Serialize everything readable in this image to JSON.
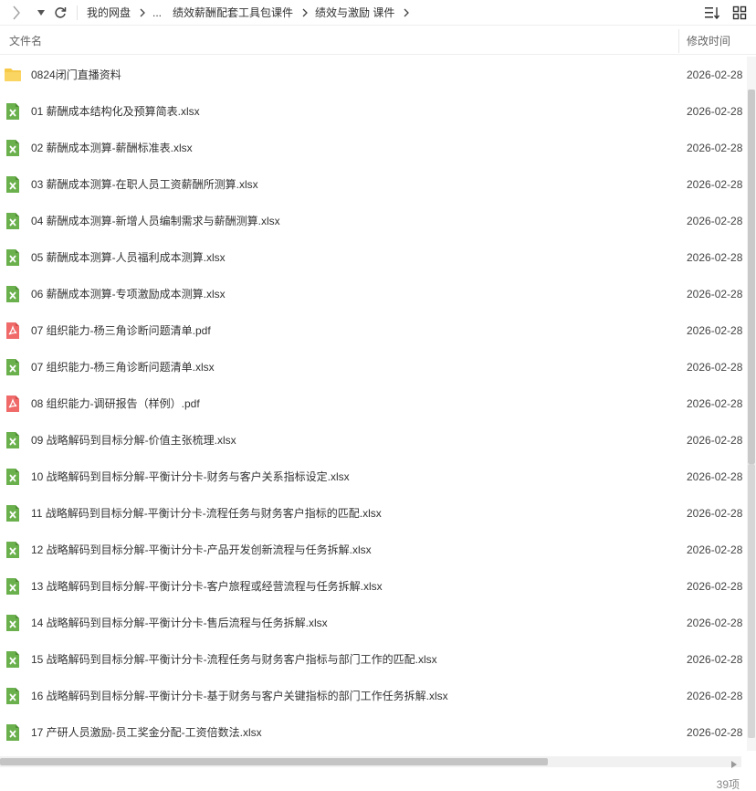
{
  "breadcrumb": {
    "root": "我的网盘",
    "ellipsis": "...",
    "parent": "绩效薪酬配套工具包课件",
    "current": "绩效与激励 课件"
  },
  "columns": {
    "name": "文件名",
    "modified": "修改时间"
  },
  "files": [
    {
      "name": "0824闭门直播资料",
      "date": "2026-02-28",
      "type": "folder"
    },
    {
      "name": "01 薪酬成本结构化及预算简表.xlsx",
      "date": "2026-02-28",
      "type": "xlsx"
    },
    {
      "name": "02 薪酬成本测算-薪酬标准表.xlsx",
      "date": "2026-02-28",
      "type": "xlsx"
    },
    {
      "name": "03 薪酬成本测算-在职人员工资薪酬所测算.xlsx",
      "date": "2026-02-28",
      "type": "xlsx"
    },
    {
      "name": "04 薪酬成本测算-新增人员编制需求与薪酬测算.xlsx",
      "date": "2026-02-28",
      "type": "xlsx"
    },
    {
      "name": "05 薪酬成本测算-人员福利成本测算.xlsx",
      "date": "2026-02-28",
      "type": "xlsx"
    },
    {
      "name": "06 薪酬成本测算-专项激励成本测算.xlsx",
      "date": "2026-02-28",
      "type": "xlsx"
    },
    {
      "name": "07 组织能力-杨三角诊断问题清单.pdf",
      "date": "2026-02-28",
      "type": "pdf"
    },
    {
      "name": "07 组织能力-杨三角诊断问题清单.xlsx",
      "date": "2026-02-28",
      "type": "xlsx"
    },
    {
      "name": "08 组织能力-调研报告（样例）.pdf",
      "date": "2026-02-28",
      "type": "pdf"
    },
    {
      "name": "09 战略解码到目标分解-价值主张梳理.xlsx",
      "date": "2026-02-28",
      "type": "xlsx"
    },
    {
      "name": "10 战略解码到目标分解-平衡计分卡-财务与客户关系指标设定.xlsx",
      "date": "2026-02-28",
      "type": "xlsx"
    },
    {
      "name": "11 战略解码到目标分解-平衡计分卡-流程任务与财务客户指标的匹配.xlsx",
      "date": "2026-02-28",
      "type": "xlsx"
    },
    {
      "name": "12 战略解码到目标分解-平衡计分卡-产品开发创新流程与任务拆解.xlsx",
      "date": "2026-02-28",
      "type": "xlsx"
    },
    {
      "name": "13 战略解码到目标分解-平衡计分卡-客户旅程或经营流程与任务拆解.xlsx",
      "date": "2026-02-28",
      "type": "xlsx"
    },
    {
      "name": "14 战略解码到目标分解-平衡计分卡-售后流程与任务拆解.xlsx",
      "date": "2026-02-28",
      "type": "xlsx"
    },
    {
      "name": "15 战略解码到目标分解-平衡计分卡-流程任务与财务客户指标与部门工作的匹配.xlsx",
      "date": "2026-02-28",
      "type": "xlsx"
    },
    {
      "name": "16 战略解码到目标分解-平衡计分卡-基于财务与客户关键指标的部门工作任务拆解.xlsx",
      "date": "2026-02-28",
      "type": "xlsx"
    },
    {
      "name": "17 产研人员激励-员工奖金分配-工资倍数法.xlsx",
      "date": "2026-02-28",
      "type": "xlsx"
    }
  ],
  "status": {
    "count": "39项"
  },
  "colors": {
    "folder": "#f7c948",
    "xlsx": "#6ab04c",
    "pdf": "#f06a6a"
  }
}
